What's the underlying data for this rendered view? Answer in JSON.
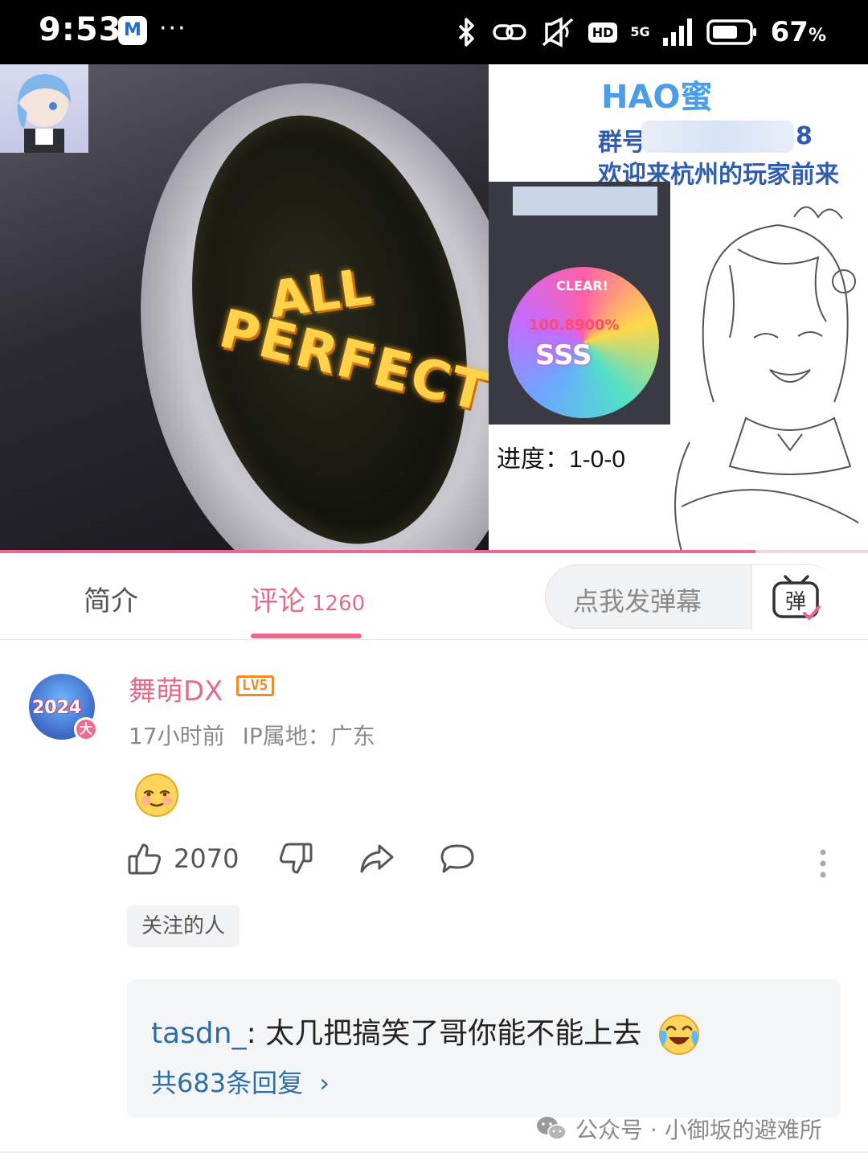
{
  "status_bar": {
    "time": "9:53",
    "app_icon_letter": "M",
    "more": "···",
    "network": "5G",
    "hd": "HD",
    "battery_percent": "67",
    "percent_sign": "%"
  },
  "video": {
    "overlay_text_line1": "ALL",
    "overlay_text_line2": "PERFECT",
    "poster_title": "HAO蜜",
    "poster_group_prefix": "群号",
    "poster_group_suffix": "8",
    "poster_welcome": "欢迎来杭州的玩家前来",
    "score_badge": "CLEAR!",
    "score_value": "100.8900%",
    "score_rank": "SSS",
    "progress_text": "进度：1-0-0",
    "playback_progress": 0.87
  },
  "tabs": {
    "intro_label": "简介",
    "comments_label": "评论",
    "comments_count": "1260",
    "danmaku_placeholder": "点我发弹幕",
    "danmaku_button_glyph": "弹"
  },
  "comment": {
    "username": "舞萌DX",
    "level": "LV5",
    "avatar_text": "2024",
    "avatar_badge": "大",
    "time": "17小时前",
    "ip_location": "IP属地：广东",
    "content_emoji": "smiling-face-emoji",
    "like_count": "2070",
    "tag": "关注的人",
    "reply": {
      "author": "tasdn_",
      "separator": ":",
      "text": "太几把搞笑了哥你能不能上去",
      "emoji": "laughing-crying-emoji",
      "count_label": "共683条回复",
      "chevron": "›"
    }
  },
  "watermark": {
    "text": "公众号 · 小御坂的避难所"
  },
  "colors": {
    "accent_pink": "#e66a8c",
    "link_blue": "#2e6ea8",
    "level_orange": "#f08a24"
  }
}
